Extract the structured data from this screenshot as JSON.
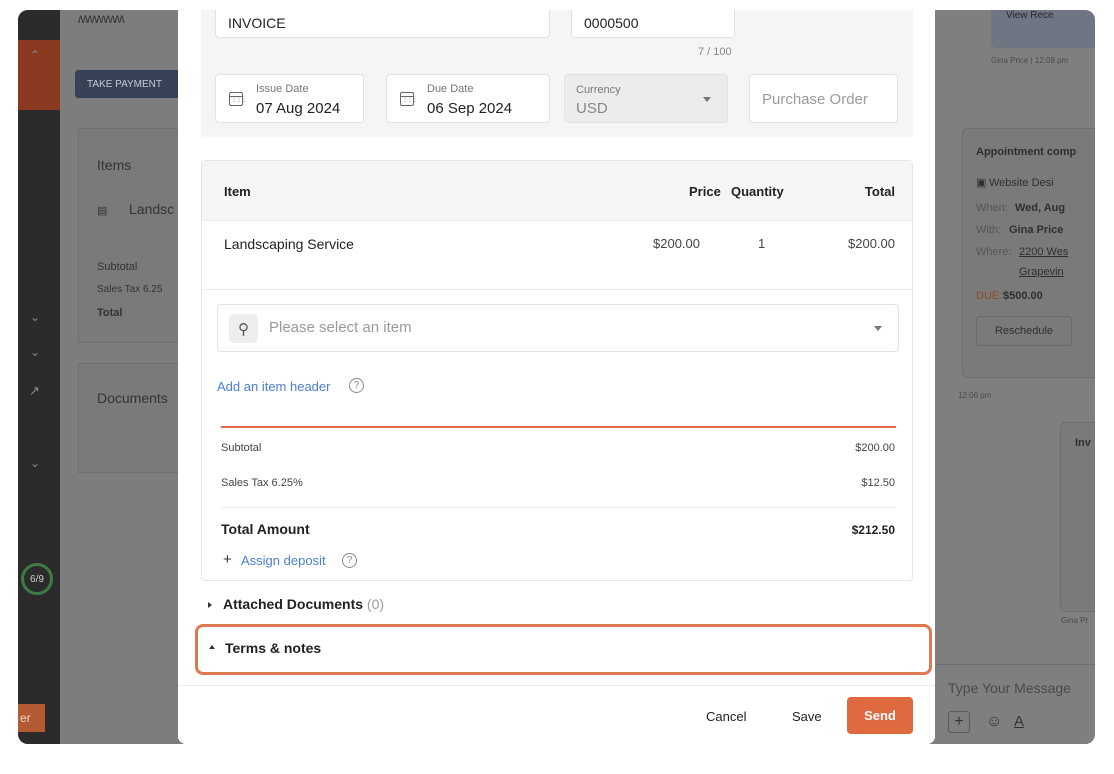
{
  "background": {
    "take_payment": "TAKE PAYMENT",
    "items_title": "Items",
    "item_row": "Landsc",
    "subtotal": "Subtotal",
    "sales_tax": "Sales Tax 6.25",
    "total": "Total",
    "documents": "Documents",
    "step": "6/9",
    "orange_btn": "er",
    "view_receipt": "View Rece",
    "chat_meta": "Gina Price | 12:08 pm",
    "appt_title": "Appointment comp",
    "appt_service": "Website Desi",
    "appt_when_lbl": "When:",
    "appt_when": "Wed, Aug",
    "appt_with_lbl": "With:",
    "appt_with": "Gina Price",
    "appt_where_lbl": "Where:",
    "appt_where": "2200 Wes",
    "appt_where2": "Grapevin",
    "appt_due_lbl": "DUE:",
    "appt_due": "$500.00",
    "reschedule": "Reschedule",
    "time2": "12:06 pm",
    "inv_label": "Inv",
    "inv_meta": "Gina Pr",
    "message_placeholder": "Type Your Message"
  },
  "invoice": {
    "title_value": "INVOICE",
    "title_counter": "7 / 100",
    "number_value": "0000500",
    "issue_date_label": "Issue Date",
    "issue_date": "07 Aug 2024",
    "due_date_label": "Due Date",
    "due_date": "06 Sep 2024",
    "currency_label": "Currency",
    "currency": "USD",
    "po_placeholder": "Purchase Order"
  },
  "items": {
    "headers": {
      "item": "Item",
      "price": "Price",
      "quantity": "Quantity",
      "total": "Total"
    },
    "rows": [
      {
        "name": "Landscaping Service",
        "price": "$200.00",
        "quantity": "1",
        "total": "$200.00"
      }
    ],
    "select_placeholder": "Please select an item",
    "add_header": "Add an item header",
    "subtotal_label": "Subtotal",
    "subtotal": "$200.00",
    "tax_label": "Sales Tax 6.25%",
    "tax": "$12.50",
    "total_label": "Total Amount",
    "total": "$212.50",
    "assign_deposit": "Assign deposit"
  },
  "sections": {
    "attached_label": "Attached Documents",
    "attached_count": "(0)",
    "terms_label": "Terms & notes"
  },
  "footer": {
    "cancel": "Cancel",
    "save": "Save",
    "send": "Send"
  }
}
